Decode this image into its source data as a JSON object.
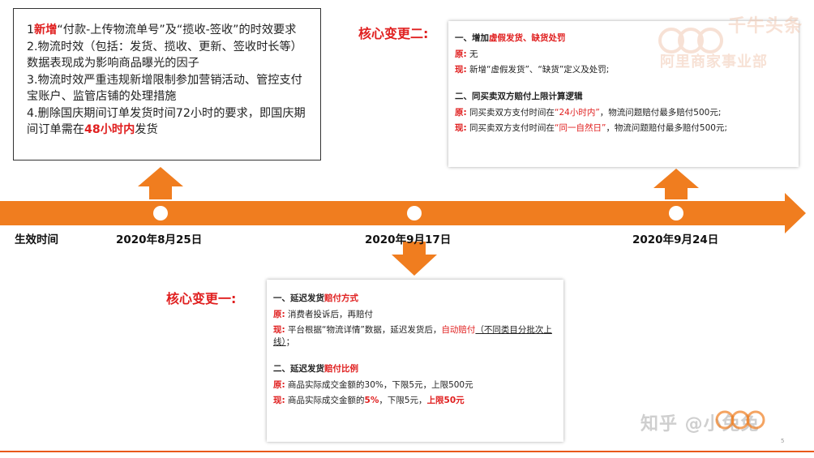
{
  "colors": {
    "accent": "#f07d1f",
    "highlight": "#e02020",
    "line": "#e85a1a"
  },
  "left_box": {
    "line1_num": "1",
    "line1_red": "新增",
    "line1_rest": "“付款-上传物流单号”及“揽收-签收”的时效要求",
    "line2": "2.物流时效（包括：发货、揽收、更新、签收时长等）数据表现成为影响商品曝光的因子",
    "line3": "3.物流时效严重违规新增限制参加营销活动、管控支付宝账户、监管店铺的处理措施",
    "line4_pre": "4.删除国庆期间订单发货时间72小时的要求，即国庆期间订单需在",
    "line4_red": "48小时内",
    "line4_post": "发货"
  },
  "timeline": {
    "title": "生效时间",
    "dates": [
      "2020年8月25日",
      "2020年9月17日",
      "2020年9月24日"
    ]
  },
  "change_two": {
    "heading": "核心变更二:",
    "s1_title_pre": "一、增加",
    "s1_title_red": "虚假发货、缺货处罚",
    "s1_old_label": "原:",
    "s1_old": "无",
    "s1_new_label": "现:",
    "s1_new": "新增“虚假发货”、“缺货”定义及处罚;",
    "s2_title": "二、同买卖双方赔付上限计算逻辑",
    "s2_old_label": "原:",
    "s2_old_pre": "同买卖双方支付时间在",
    "s2_old_red": "“24小时内”",
    "s2_old_post": "，物流问题赔付最多赔付500元;",
    "s2_new_label": "现:",
    "s2_new_pre": "同买卖双方支付时间在",
    "s2_new_red": "“同一自然日”",
    "s2_new_post": "，物流问题赔付最多赔付500元;"
  },
  "change_one": {
    "heading": "核心变更一:",
    "s1_title_pre": "一、延迟发货",
    "s1_title_red": "赔付方式",
    "s1_old_label": "原:",
    "s1_old": "消费者投诉后，再赔付",
    "s1_new_label": "现:",
    "s1_new_pre": "平台根据“物流详情”数据，延迟发货后，",
    "s1_new_red": "自动赔付",
    "s1_new_ul": "（不同类目分批次上线）",
    "s1_new_post": "；",
    "s2_title_pre": "二、延迟发货",
    "s2_title_red": "赔付比例",
    "s2_old_label": "原:",
    "s2_old": "商品实际成交金额的30%，下限5元，上限500元",
    "s2_new_label": "现:",
    "s2_new_pre": "商品实际成交金额的",
    "s2_new_red1": "5%",
    "s2_new_mid": "，下限5元，",
    "s2_new_red2": "上限50元"
  },
  "watermark": {
    "top_line1": "千牛头条",
    "top_line2": "阿里商家事业部",
    "zhihu": "知乎 @小兔兔",
    "page_number": "5"
  }
}
